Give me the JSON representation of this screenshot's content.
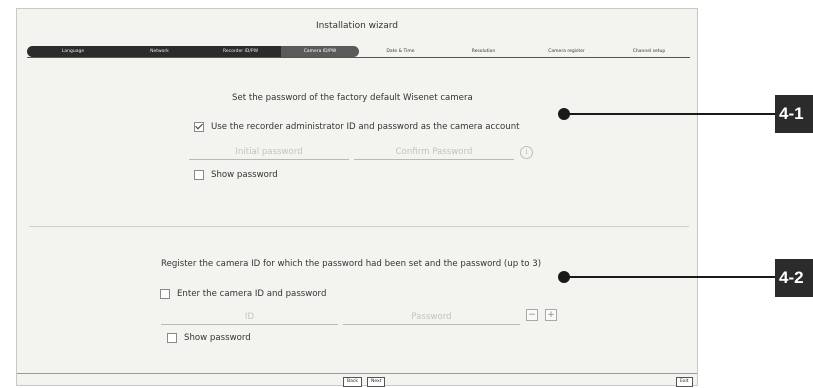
{
  "window": {
    "title": "Installation wizard"
  },
  "steps": [
    {
      "label": "Language",
      "state": "done"
    },
    {
      "label": "Network",
      "state": "done"
    },
    {
      "label": "Recorder ID/PW",
      "state": "done"
    },
    {
      "label": "Camera ID/PW",
      "state": "current"
    },
    {
      "label": "Date & Time",
      "state": "pending"
    },
    {
      "label": "Resolution",
      "state": "pending"
    },
    {
      "label": "Camera register",
      "state": "pending"
    },
    {
      "label": "Channel setup",
      "state": "pending"
    }
  ],
  "section1": {
    "heading": "Set the password of the factory default Wisenet camera",
    "use_admin_label": "Use the recorder administrator ID and password as the camera account",
    "use_admin_checked": true,
    "initial_password_placeholder": "Initial password",
    "confirm_password_placeholder": "Confirm Password",
    "info_icon": "i",
    "show_password_label": "Show password",
    "show_password_checked": false
  },
  "section2": {
    "heading": "Register the camera ID for which the password had been set and the password (up to 3)",
    "enter_id_label": "Enter the camera ID and password",
    "enter_id_checked": false,
    "id_placeholder": "ID",
    "password_placeholder": "Password",
    "minus": "−",
    "plus": "+",
    "show_password_label": "Show password",
    "show_password_checked": false
  },
  "footer": {
    "back": "Back",
    "next": "Next",
    "exit": "Exit"
  },
  "callouts": {
    "first": "4-1",
    "second": "4-2"
  },
  "colors": {
    "panel": "#f3f3ef",
    "step_done": "#2b2b2b",
    "step_current": "#5a5a5a",
    "callout": "#2b2b2b"
  }
}
